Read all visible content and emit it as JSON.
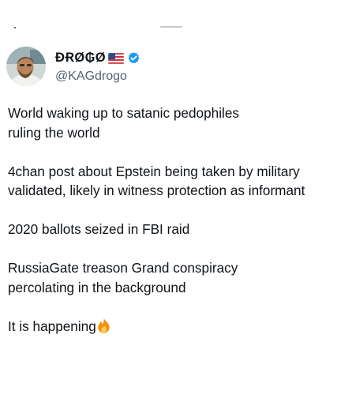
{
  "author": {
    "display_name": "ÐɌØ₲Ø",
    "handle": "@KAGdrogo",
    "avatar_icon": "profile-photo",
    "flag_icon": "us-flag-icon",
    "verified_icon": "verified-badge-icon",
    "verified_color": "#1d9bf0"
  },
  "tweet": {
    "paragraphs": [
      "World waking up to satanic pedophiles\nruling the world",
      "4chan post about Epstein being taken by military\nvalidated, likely in witness protection as informant",
      "2020 ballots seized in FBI raid",
      "RussiaGate treason Grand conspiracy\npercolating in the background",
      "It is happening"
    ],
    "trailing_emoji_icon": "fire-emoji-icon"
  },
  "colors": {
    "text": "#0f1419",
    "secondary_text": "#536471",
    "background": "#ffffff"
  }
}
